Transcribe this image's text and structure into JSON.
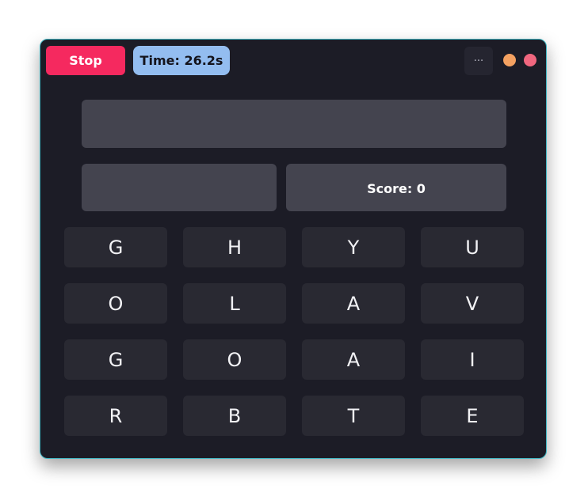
{
  "toolbar": {
    "stop_label": "Stop",
    "timer_label": "Time: 26.2s",
    "menu_label": "···"
  },
  "window_controls": {
    "minimize_color": "#f4a161",
    "close_color": "#f1677f"
  },
  "game": {
    "current_word": "",
    "found_words": "",
    "score_label": "Score: 0"
  },
  "grid": {
    "rows": [
      [
        "G",
        "H",
        "Y",
        "U"
      ],
      [
        "O",
        "L",
        "A",
        "V"
      ],
      [
        "G",
        "O",
        "A",
        "I"
      ],
      [
        "R",
        "B",
        "T",
        "E"
      ]
    ]
  },
  "colors": {
    "accent_stop": "#f5295f",
    "accent_timer": "#93bdf0",
    "window_border": "#3fb7c4"
  }
}
